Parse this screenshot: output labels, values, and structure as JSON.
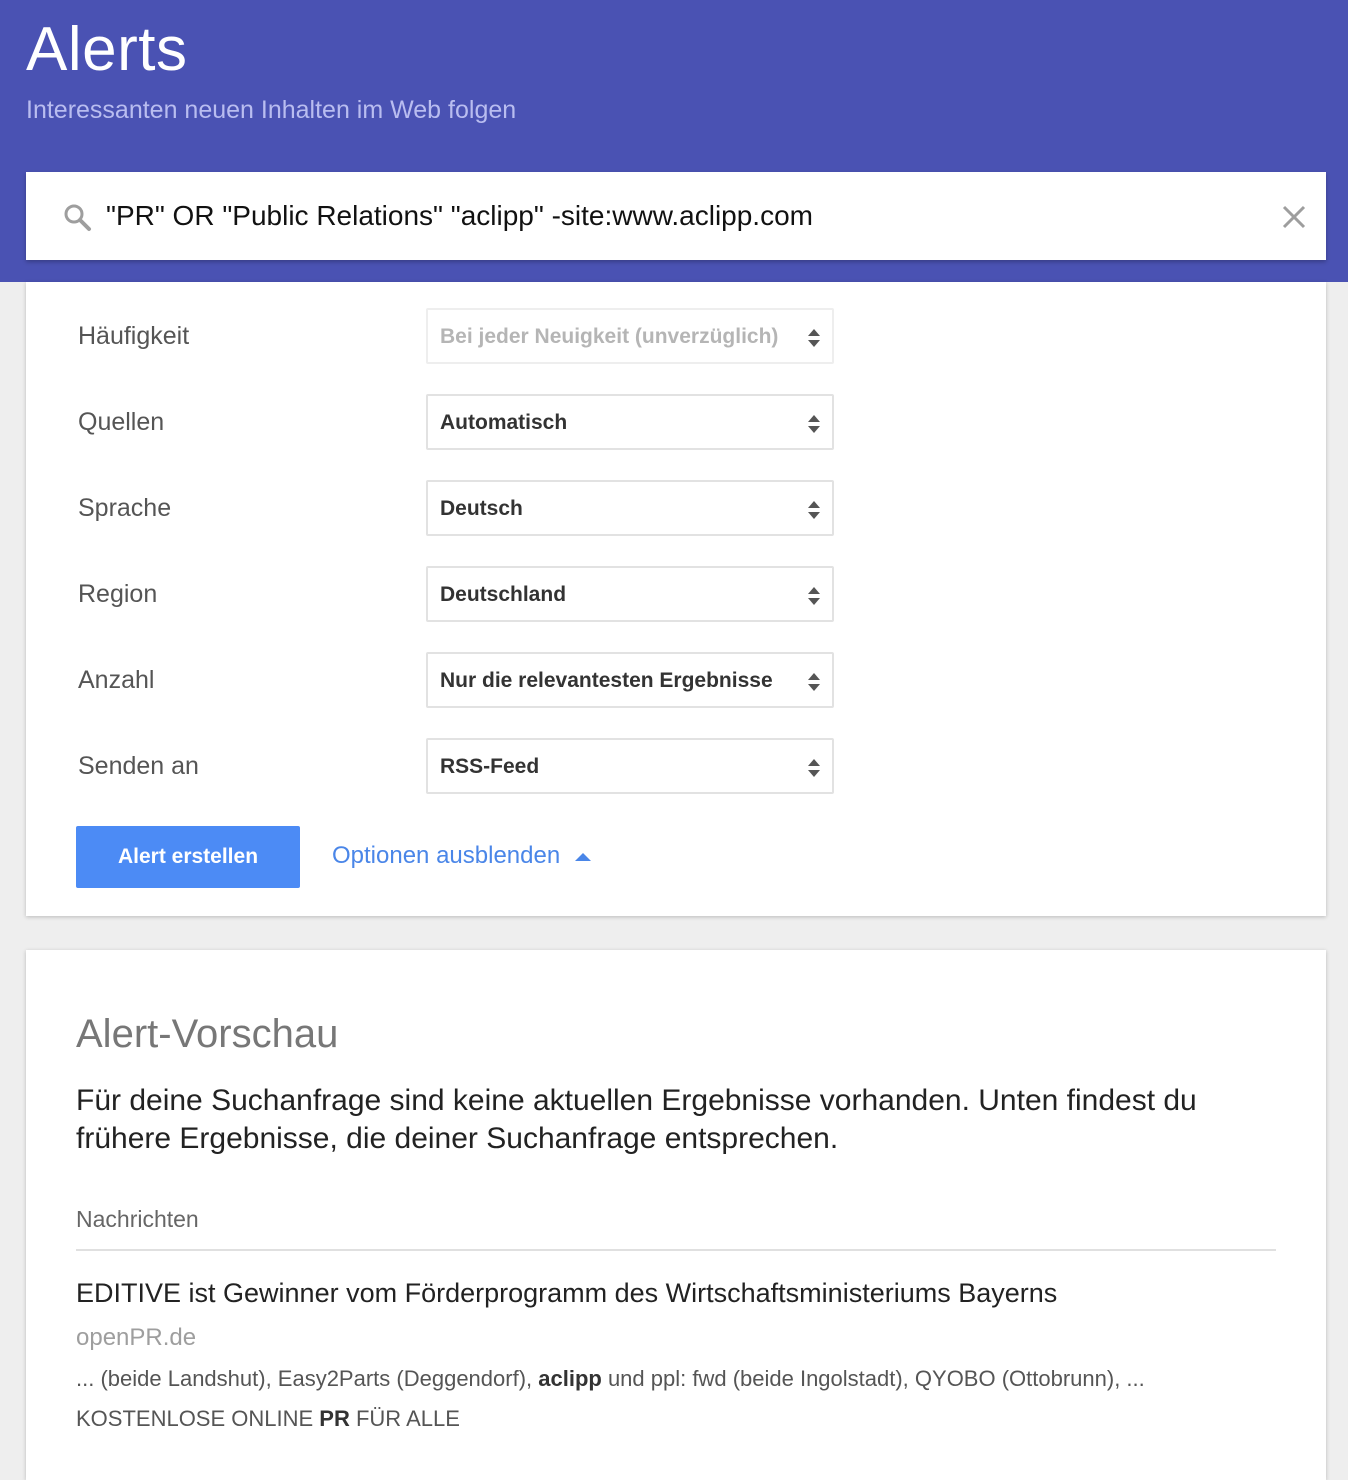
{
  "header": {
    "title": "Alerts",
    "subtitle": "Interessanten neuen Inhalten im Web folgen",
    "background_color": "#4a52b3"
  },
  "search": {
    "query": "\"PR\" OR \"Public Relations\" \"aclipp\" -site:www.aclipp.com",
    "icon": "search-icon",
    "clear_icon": "close-icon"
  },
  "options": {
    "rows": [
      {
        "label": "Häufigkeit",
        "value": "Bei jeder Neuigkeit (unverzüglich)",
        "disabled": true
      },
      {
        "label": "Quellen",
        "value": "Automatisch",
        "disabled": false
      },
      {
        "label": "Sprache",
        "value": "Deutsch",
        "disabled": false
      },
      {
        "label": "Region",
        "value": "Deutschland",
        "disabled": false
      },
      {
        "label": "Anzahl",
        "value": "Nur die relevantesten Ergebnisse",
        "disabled": false
      },
      {
        "label": "Senden an",
        "value": "RSS-Feed",
        "disabled": false
      }
    ],
    "create_button": "Alert erstellen",
    "toggle_link": "Optionen ausblenden",
    "accent_color": "#4c8bf5"
  },
  "preview": {
    "title": "Alert-Vorschau",
    "message": "Für deine Suchanfrage sind keine aktuellen Ergebnisse vorhanden. Unten findest du frühere Ergebnisse, die deiner Suchanfrage entsprechen.",
    "section": "Nachrichten",
    "result": {
      "title": "EDITIVE ist Gewinner vom Förderprogramm des Wirtschaftsministeriums Bayerns",
      "source": "openPR.de",
      "snippet_before": "... (beide Landshut), Easy2Parts (Deggendorf), ",
      "snippet_bold": "aclipp",
      "snippet_after": " und ppl: fwd (beide Ingolstadt), QYOBO (Ottobrunn), ...",
      "footer_before": "KOSTENLOSE ONLINE ",
      "footer_bold": "PR",
      "footer_after": " FÜR ALLE"
    }
  }
}
